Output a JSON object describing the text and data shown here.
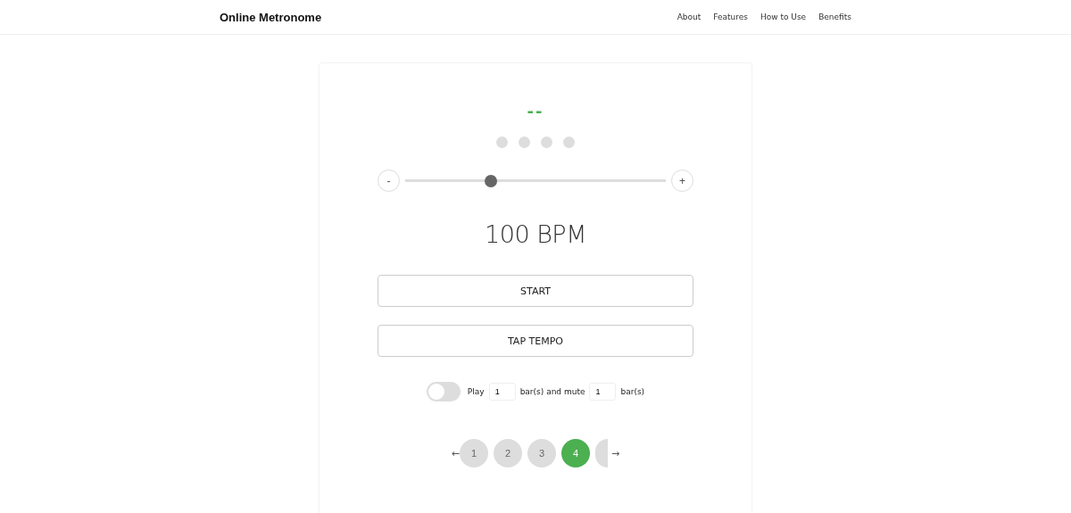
{
  "header": {
    "title": "Online Metronome",
    "nav": [
      "About",
      "Features",
      "How to Use",
      "Benefits"
    ]
  },
  "beat_display": "--",
  "beat_dots": [
    {
      "selected": false
    },
    {
      "selected": false
    },
    {
      "selected": false
    },
    {
      "selected": false
    }
  ],
  "tempo": {
    "decrease": "-",
    "increase": "+",
    "level": 0.33,
    "reading": "100 BPM"
  },
  "buttons": [
    "START",
    "TAP TEMPO"
  ],
  "mute_cycle": {
    "on": false,
    "play_label": "Play",
    "play_bars": "1",
    "middle_label": "bar(s) and mute",
    "mute_bars": "1",
    "end_label": "bar(s)"
  },
  "beats_per_bar": {
    "prev": "←",
    "next": "→",
    "options": [
      {
        "label": "1",
        "selected": false
      },
      {
        "label": "2",
        "selected": false
      },
      {
        "label": "3",
        "selected": false
      },
      {
        "label": "4",
        "selected": true
      }
    ]
  }
}
